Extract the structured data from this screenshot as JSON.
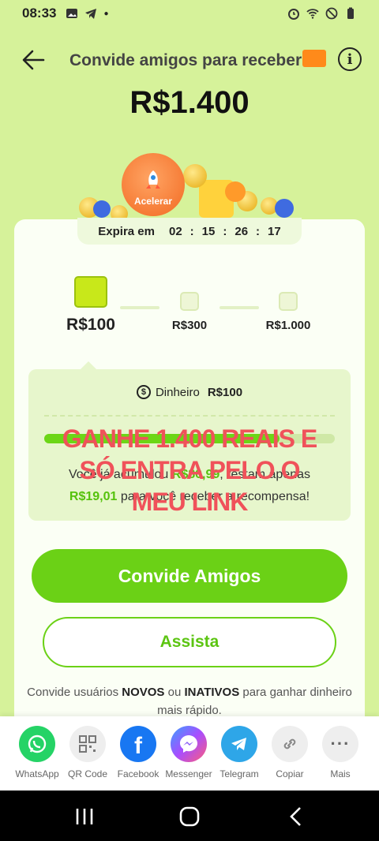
{
  "status_bar": {
    "time": "08:33"
  },
  "header": {
    "title": "Convide amigos para receber",
    "amount": "R$1.400"
  },
  "banner": {
    "accelerate_label": "Acelerar"
  },
  "countdown": {
    "label": "Expira em",
    "hours": "02",
    "minutes": "15",
    "seconds": "26",
    "centis": "17"
  },
  "steps": [
    {
      "label": "R$100"
    },
    {
      "label": "R$300"
    },
    {
      "label": "R$1.000"
    }
  ],
  "cash": {
    "label": "Dinheiro",
    "value": "R$100"
  },
  "progress": {
    "fraction": 0.81,
    "line1_pre": "Você já acumulou",
    "line1_value": "R$80,99",
    "line1_post": ", restam apenas",
    "line2_value": "R$19,01",
    "line2_post": "para você receber a recompensa!"
  },
  "overlay_text": {
    "line1": "GANHE 1.400 REAIS E",
    "line2": "SÓ ENTRA PELO O",
    "line3": "MEU LINK"
  },
  "buttons": {
    "invite": "Convide Amigos",
    "watch": "Assista"
  },
  "hint": {
    "pre": "Convide usuários",
    "novos": "NOVOS",
    "mid": "ou",
    "inativos": "INATIVOS",
    "post": "para ganhar dinheiro mais rápido."
  },
  "share": [
    {
      "label": "WhatsApp",
      "icon": "whatsapp-icon",
      "color": "#25d366"
    },
    {
      "label": "QR Code",
      "icon": "qr-code-icon",
      "color": "#eeeeee"
    },
    {
      "label": "Facebook",
      "icon": "facebook-icon",
      "color": "#1877f2"
    },
    {
      "label": "Messenger",
      "icon": "messenger-icon",
      "color": "#8a5cf6"
    },
    {
      "label": "Telegram",
      "icon": "telegram-icon",
      "color": "#2ea6e8"
    },
    {
      "label": "Copiar",
      "icon": "link-icon",
      "color": "#eeeeee"
    },
    {
      "label": "Mais",
      "icon": "more-icon",
      "color": "#eeeeee"
    }
  ],
  "colors": {
    "accent": "#6bd116",
    "background": "#d6f29a",
    "overlay": "#f0525a"
  }
}
